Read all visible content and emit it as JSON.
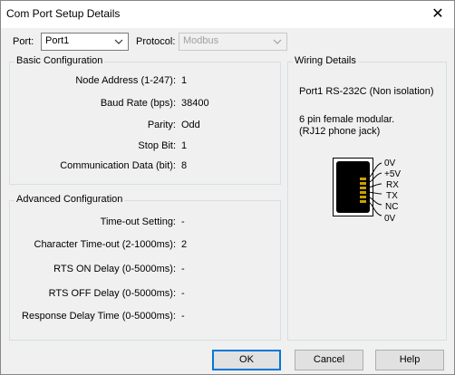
{
  "window": {
    "title": "Com Port Setup Details",
    "close_glyph": "✕"
  },
  "top": {
    "port_label": "Port:",
    "port_value": "Port1",
    "protocol_label": "Protocol:",
    "protocol_value": "Modbus"
  },
  "basic": {
    "title": "Basic Configuration",
    "rows": [
      {
        "label": "Node Address (1-247):",
        "value": "1"
      },
      {
        "label": "Baud Rate (bps):",
        "value": "38400"
      },
      {
        "label": "Parity:",
        "value": "Odd"
      },
      {
        "label": "Stop Bit:",
        "value": "1"
      },
      {
        "label": "Communication Data (bit):",
        "value": "8"
      }
    ]
  },
  "advanced": {
    "title": "Advanced Configuration",
    "rows": [
      {
        "label": "Time-out Setting:",
        "value": "-"
      },
      {
        "label": "Character Time-out (2-1000ms):",
        "value": "2"
      },
      {
        "label": "RTS ON Delay (0-5000ms):",
        "value": "-"
      },
      {
        "label": "RTS OFF Delay (0-5000ms):",
        "value": "-"
      },
      {
        "label": "Response Delay Time (0-5000ms):",
        "value": "-"
      }
    ]
  },
  "wiring": {
    "title": "Wiring Details",
    "port_line": "Port1 RS-232C (Non isolation)",
    "desc_line1": "6 pin female modular.",
    "desc_line2": "(RJ12 phone jack)",
    "pins": [
      "0V",
      "+5V",
      "RX",
      "TX",
      "NC",
      "0V"
    ]
  },
  "buttons": {
    "ok": "OK",
    "cancel": "Cancel",
    "help": "Help"
  }
}
